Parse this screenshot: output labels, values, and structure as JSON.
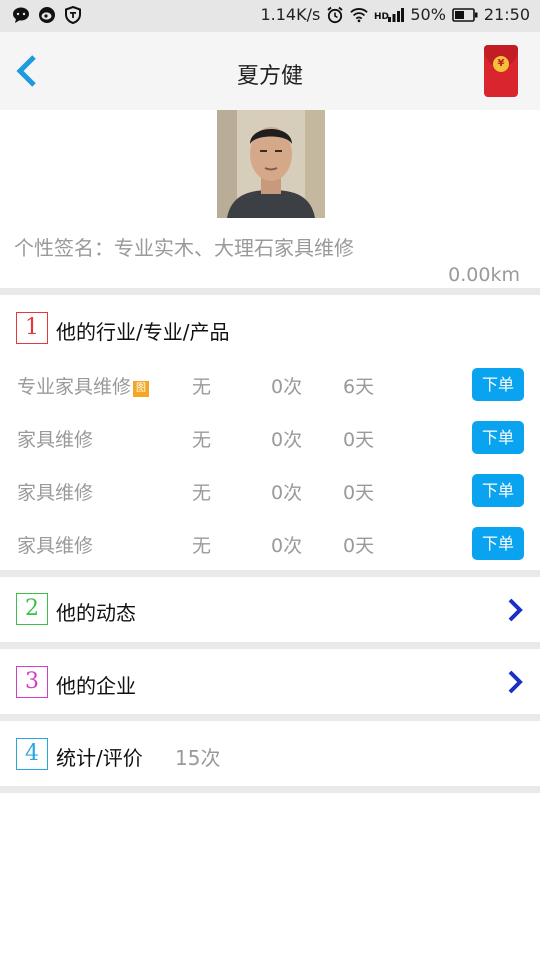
{
  "status_bar": {
    "icons_left": [
      "chat-icon",
      "weibo-icon",
      "shield-icon"
    ],
    "net_speed": "1.14K/s",
    "battery": "50%",
    "time": "21:50"
  },
  "header": {
    "title": "夏方健"
  },
  "profile": {
    "signature_label": "个性签名：",
    "signature_value": "专业实木、大理石家具维修",
    "distance": "0.00km"
  },
  "section1": {
    "num": "1",
    "title": "他的行业/专业/产品",
    "rows": [
      {
        "name": "专业家具维修",
        "tag": "图",
        "col_a": "无",
        "col_b": "0次",
        "col_c": "6天",
        "button": "下单"
      },
      {
        "name": "家具维修",
        "tag": "",
        "col_a": "无",
        "col_b": "0次",
        "col_c": "0天",
        "button": "下单"
      },
      {
        "name": "家具维修",
        "tag": "",
        "col_a": "无",
        "col_b": "0次",
        "col_c": "0天",
        "button": "下单"
      },
      {
        "name": "家具维修",
        "tag": "",
        "col_a": "无",
        "col_b": "0次",
        "col_c": "0天",
        "button": "下单"
      }
    ]
  },
  "section2": {
    "num": "2",
    "title": "他的动态"
  },
  "section3": {
    "num": "3",
    "title": "他的企业"
  },
  "section4": {
    "num": "4",
    "title": "统计/评价",
    "extra": "15次"
  },
  "colors": {
    "accent_blue": "#0aa3f0",
    "back_arrow": "#1e9be0",
    "chevron": "#1b2fc7",
    "num1": "#e5383b",
    "num2": "#3cc04a",
    "num3": "#d23fc4",
    "num4": "#2aa6e0"
  }
}
